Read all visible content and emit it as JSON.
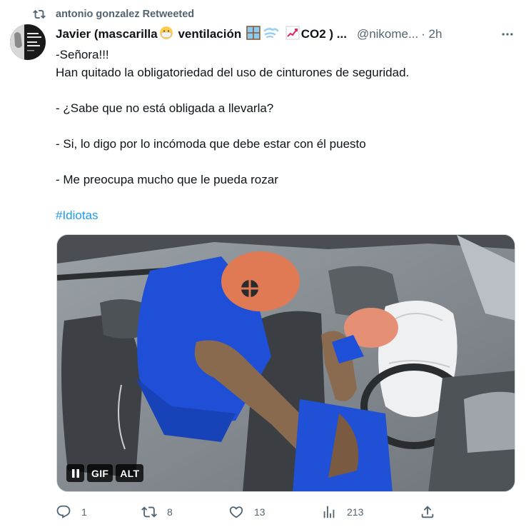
{
  "retweet": {
    "text": "antonio gonzalez Retweeted",
    "icon": "retweet-icon"
  },
  "author": {
    "name_prefix": "Javier (mascarilla",
    "name_mid": " ventilación ",
    "name_suffix": "CO2 ) ...",
    "handle": "@nikome...",
    "time": "· 2h",
    "emojis": [
      "mask-emoji",
      "window-emoji",
      "wind-emoji",
      "chart-increasing-emoji"
    ]
  },
  "tweet": {
    "lines": [
      "-Señora!!!",
      "Han quitado la obligatoriedad del uso de cinturones de seguridad.",
      "",
      "- ¿Sabe que no está obligada a llevarla?",
      "",
      "- Si, lo digo por lo incómoda que debe estar con él puesto",
      "",
      "- Me preocupa mucho que le pueda rozar",
      ""
    ],
    "hashtag": "#Idiotas"
  },
  "media": {
    "type": "gif",
    "description_badges": {
      "pause": "II",
      "gif": "GIF",
      "alt": "ALT"
    }
  },
  "actions": {
    "reply_count": "1",
    "retweet_count": "8",
    "like_count": "13",
    "views_count": "213"
  },
  "colors": {
    "text": "#0f1419",
    "secondary": "#536471",
    "link": "#1d9bf0"
  }
}
